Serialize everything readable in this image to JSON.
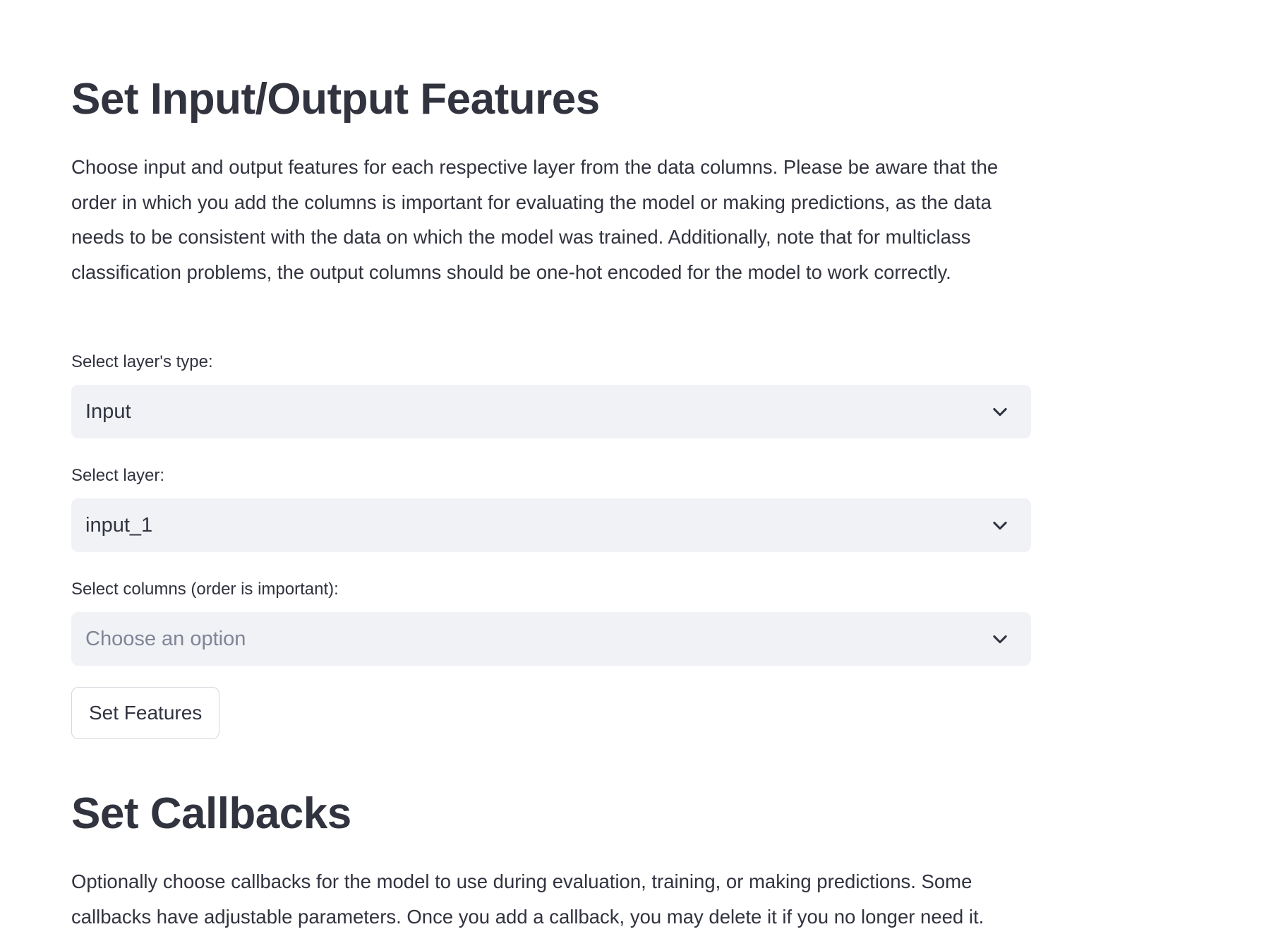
{
  "features_section": {
    "title": "Set Input/Output Features",
    "description": "Choose input and output features for each respective layer from the data columns. Please be aware that the order in which you add the columns is important for evaluating the model or making predictions, as the data needs to be consistent with the data on which the model was trained. Additionally, note that for multiclass classification problems, the output columns should be one-hot encoded for the model to work correctly.",
    "layer_type": {
      "label": "Select layer's type:",
      "value": "Input"
    },
    "layer": {
      "label": "Select layer:",
      "value": "input_1"
    },
    "columns": {
      "label": "Select columns (order is important):",
      "placeholder": "Choose an option"
    },
    "set_button_label": "Set Features"
  },
  "callbacks_section": {
    "title": "Set Callbacks",
    "description": "Optionally choose callbacks for the model to use during evaluation, training, or making predictions. Some callbacks have adjustable parameters. Once you add a callback, you may delete it if you no longer need it."
  },
  "icons": {
    "dropdown": "chevron-down-icon"
  },
  "colors": {
    "text": "#31333f",
    "select_bg": "#f0f2f6",
    "placeholder": "#808495",
    "button_border": "#d5d7de"
  }
}
